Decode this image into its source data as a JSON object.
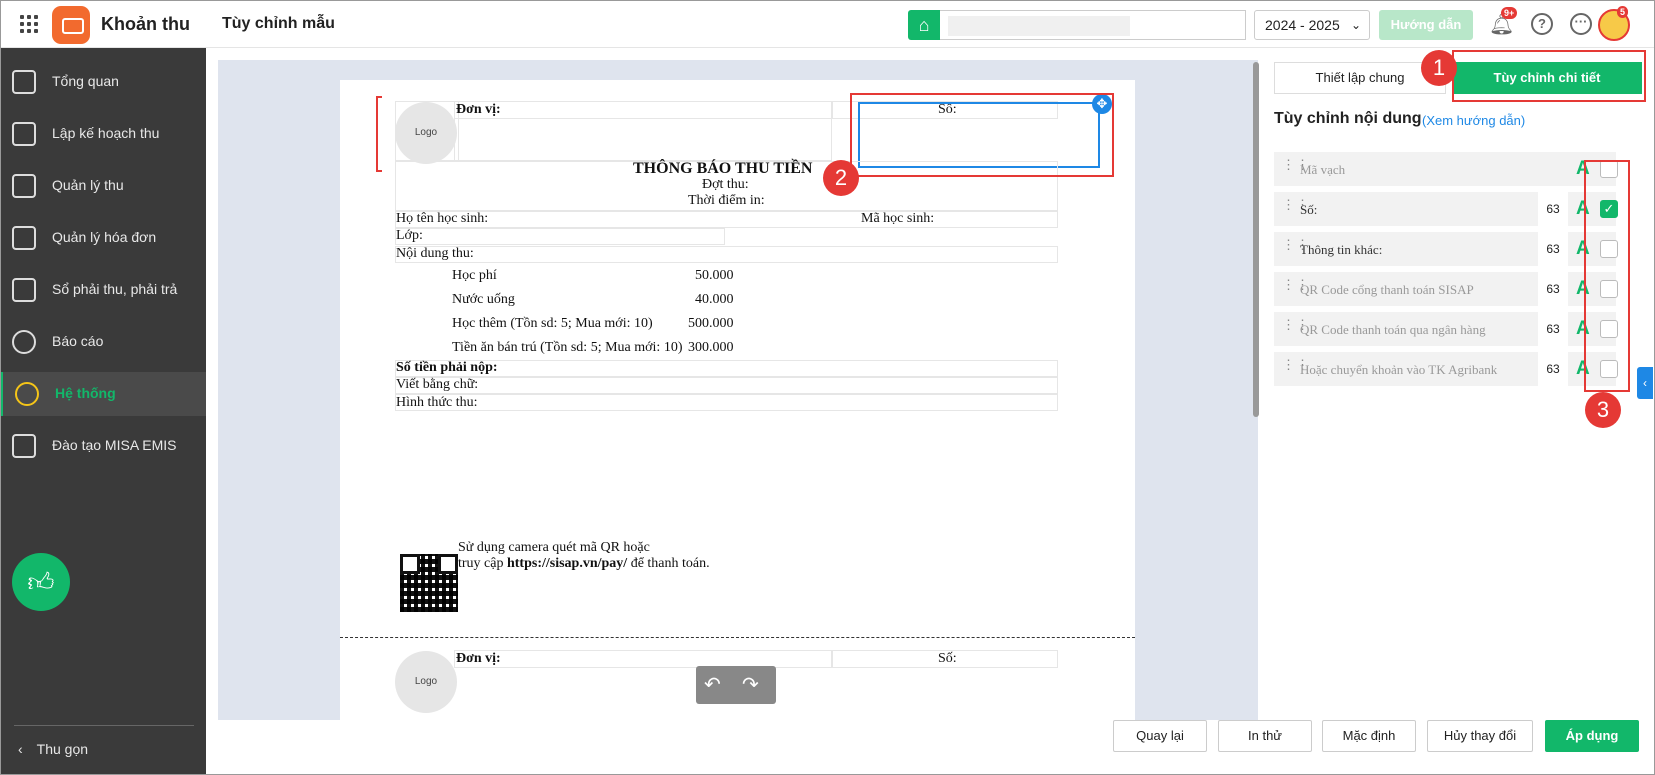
{
  "app": {
    "name": "Khoản thu",
    "page_title": "Tùy chỉnh mẫu"
  },
  "header": {
    "year": "2024 - 2025",
    "guide_label": "Hướng dẫn",
    "notif_badge": "9+",
    "avatar_badge": "5"
  },
  "sidebar": {
    "items": [
      {
        "label": "Tổng quan",
        "icon": "bar-chart-icon"
      },
      {
        "label": "Lập kế hoạch thu",
        "icon": "calendar-icon"
      },
      {
        "label": "Quản lý thu",
        "icon": "money-hand-icon"
      },
      {
        "label": "Quản lý hóa đơn",
        "icon": "document-icon"
      },
      {
        "label": "Sổ phải thu, phải trả",
        "icon": "ledger-icon"
      },
      {
        "label": "Báo cáo",
        "icon": "pie-chart-icon"
      },
      {
        "label": "Hệ thống",
        "icon": "gear-icon"
      },
      {
        "label": "Đào tạo MISA EMIS",
        "icon": "book-icon"
      }
    ],
    "active_index": 6,
    "collapse_label": "Thu gọn"
  },
  "paper": {
    "unit_label": "Đơn vị:",
    "logo_text": "Logo",
    "so_label": "Số:",
    "title": "THÔNG BÁO THU TIỀN",
    "dot_thu": "Đợt thu:",
    "thoi_diem_in": "Thời điểm in:",
    "ho_ten": "Họ tên học sinh:",
    "ma_hs": "Mã học sinh:",
    "lop": "Lớp:",
    "noi_dung": "Nội dung thu:",
    "fees": [
      {
        "name": "Học phí",
        "amount": "50.000"
      },
      {
        "name": "Nước uống",
        "amount": "40.000"
      },
      {
        "name": "Học thêm (Tồn sd: 5; Mua mới: 10)",
        "amount": "500.000"
      },
      {
        "name": "Tiền ăn bán trú (Tồn sd: 5; Mua mới: 10)",
        "amount": "300.000"
      }
    ],
    "so_tien": "Số tiền phải nộp:",
    "bang_chu": "Viết bằng chữ:",
    "hinh_thuc": "Hình thức thu:",
    "qr_line1": "Sử dụng camera quét mã QR hoặc",
    "qr_line2_pre": "truy cập ",
    "qr_url": "https://sisap.vn/pay/",
    "qr_line2_post": " để thanh toán."
  },
  "panel": {
    "tab_general": "Thiết lập chung",
    "tab_detail": "Tùy chỉnh chi tiết",
    "section_title": "Tùy chỉnh nội dung",
    "section_link": "(Xem hướng dẫn)",
    "rows": [
      {
        "label": "Mã vạch",
        "size": "",
        "checked": false,
        "disabled": true
      },
      {
        "label": "Số:",
        "size": "63",
        "checked": true,
        "disabled": false
      },
      {
        "label": "Thông tin khác:",
        "size": "63",
        "checked": false,
        "disabled": false
      },
      {
        "label": "QR Code cổng thanh toán SISAP",
        "size": "63",
        "checked": false,
        "disabled": true
      },
      {
        "label": "QR Code thanh toán qua ngân hàng",
        "size": "63",
        "checked": false,
        "disabled": true
      },
      {
        "label": "Hoặc chuyển khoản vào TK Agribank",
        "size": "63",
        "checked": false,
        "disabled": true
      }
    ]
  },
  "footer": {
    "back": "Quay lại",
    "print": "In thử",
    "default": "Mặc định",
    "cancel": "Hủy thay đổi",
    "apply": "Áp dụng"
  },
  "annotations": {
    "c1": "1",
    "c2": "2",
    "c3": "3"
  },
  "colors": {
    "accent": "#12b76a",
    "annotation": "#e53935",
    "selection": "#1e88e5"
  }
}
